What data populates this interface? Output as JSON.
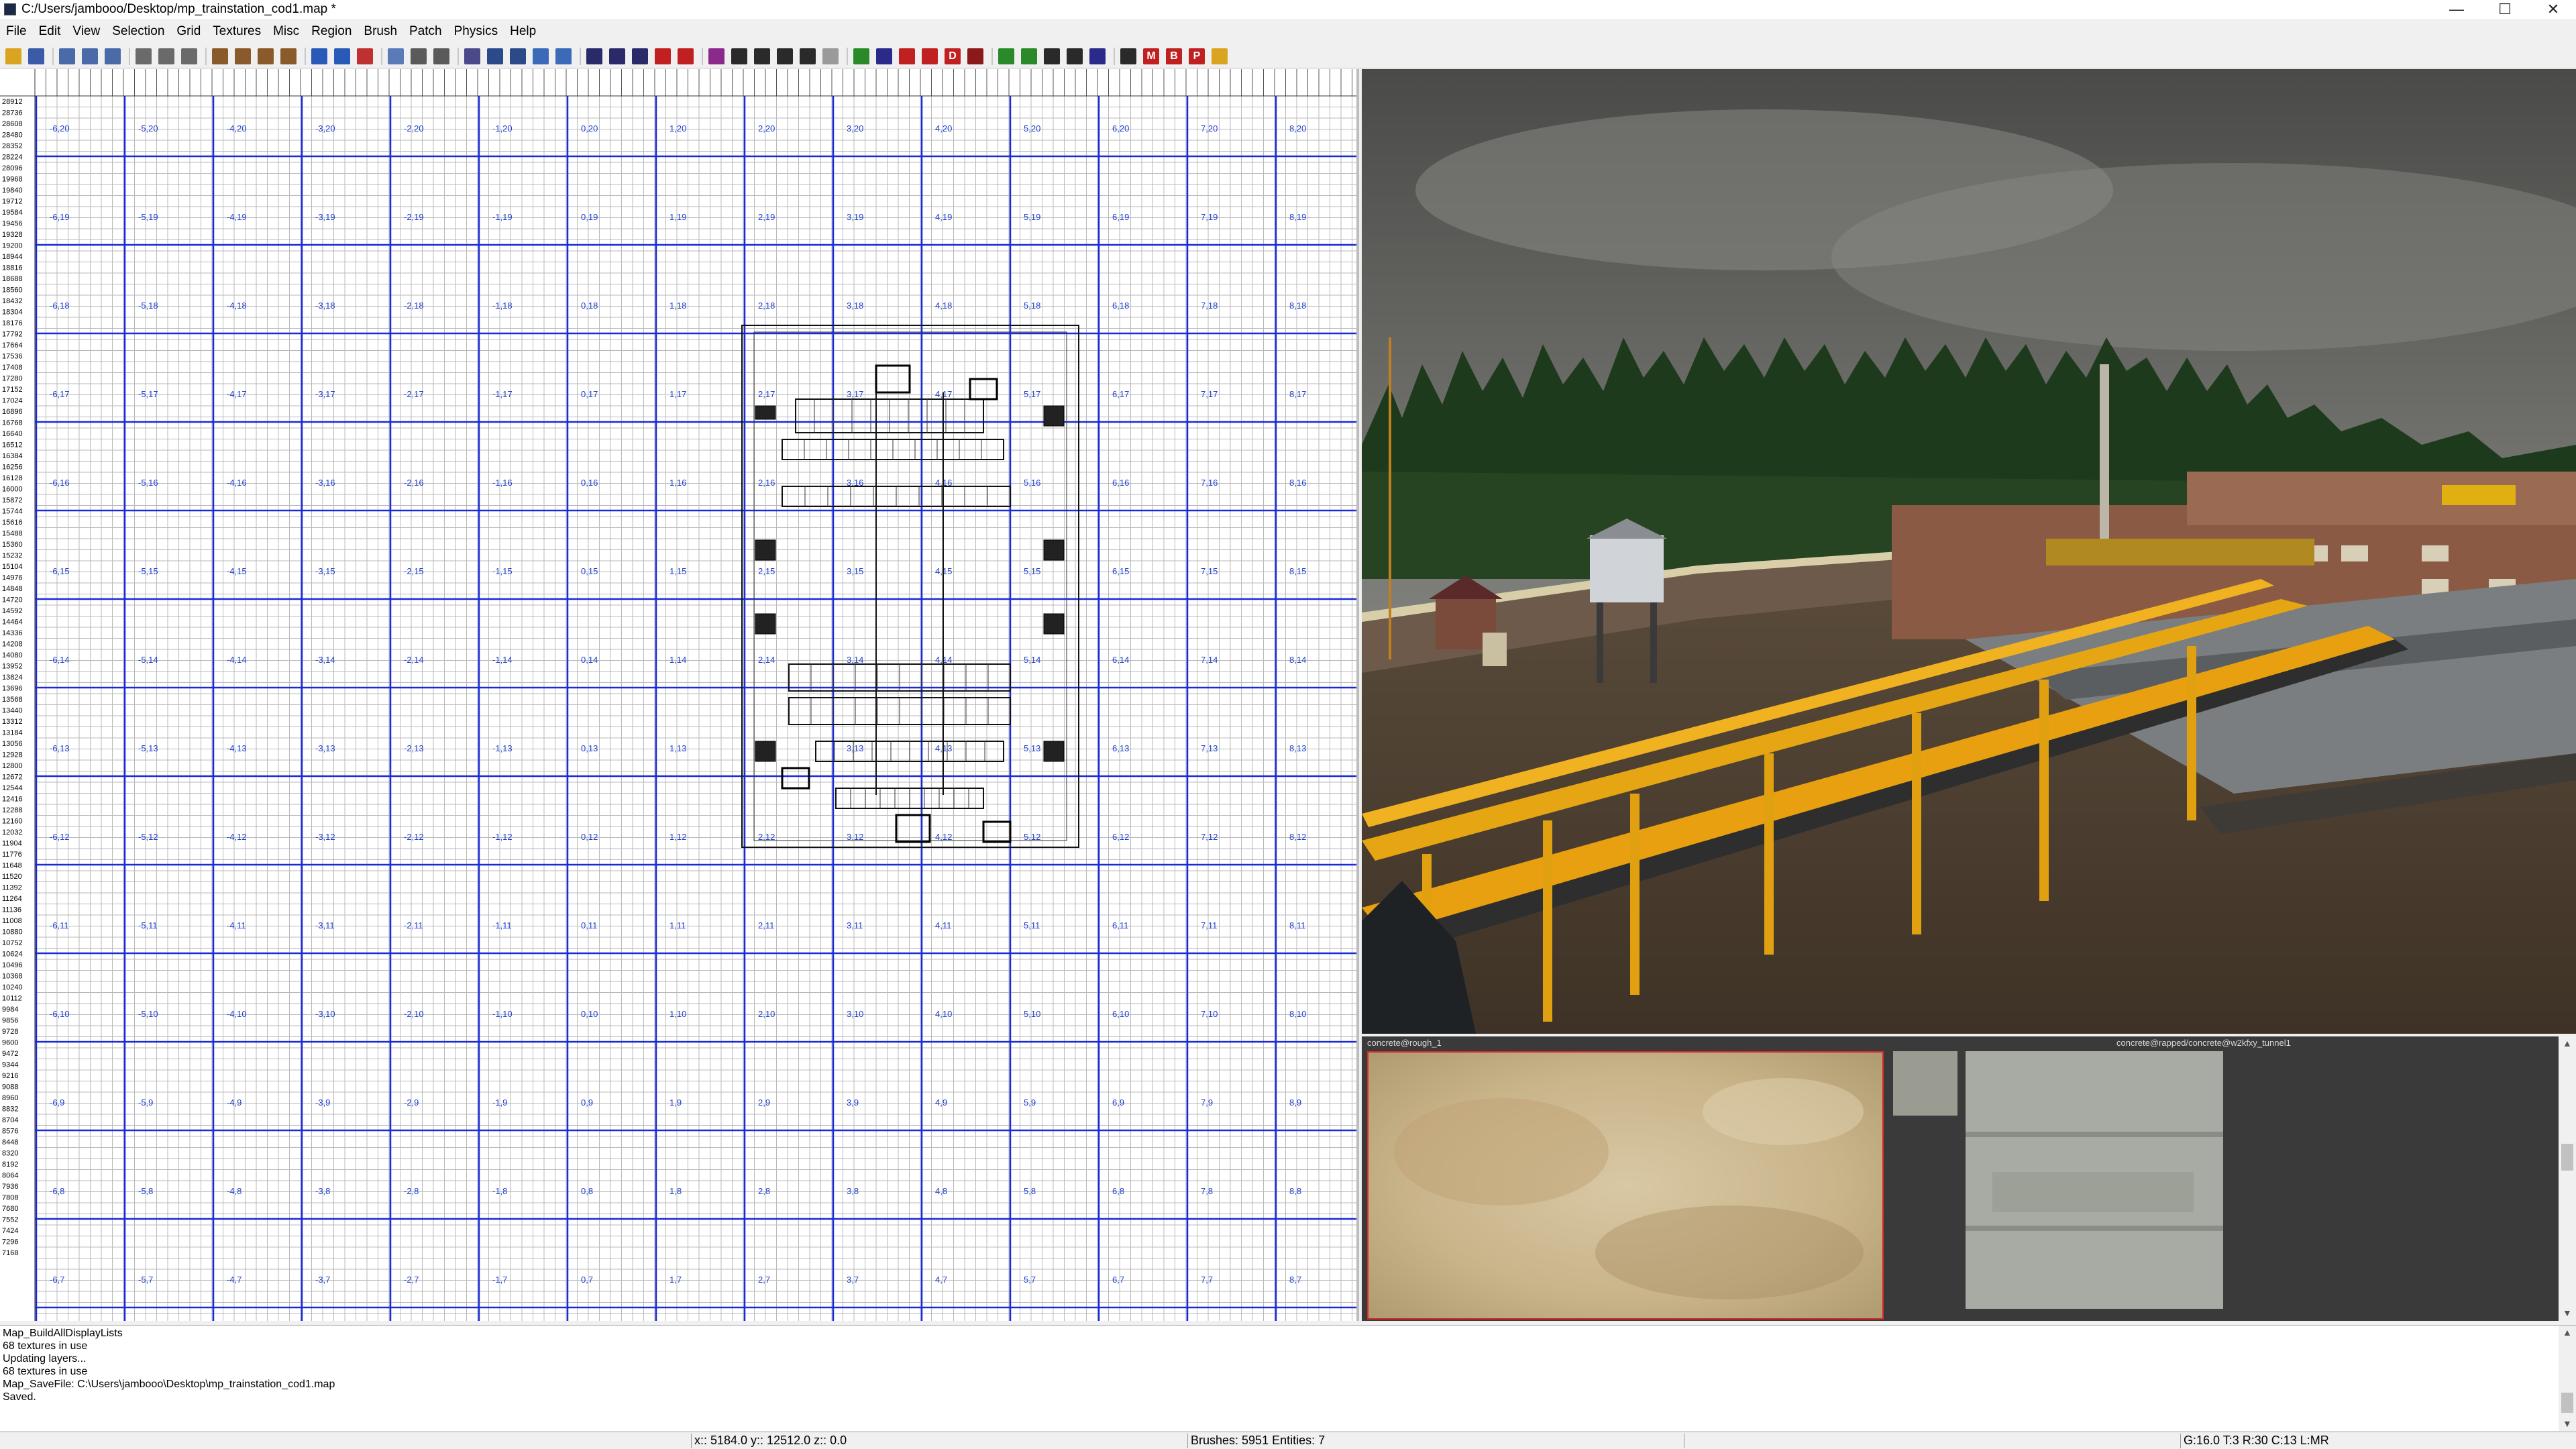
{
  "window": {
    "title": "C:/Users/jambooo/Desktop/mp_trainstation_cod1.map *",
    "minimize": "—",
    "maximize": "☐",
    "close": "✕"
  },
  "menu": {
    "items": [
      "File",
      "Edit",
      "View",
      "Selection",
      "Grid",
      "Textures",
      "Misc",
      "Region",
      "Brush",
      "Patch",
      "Physics",
      "Help"
    ]
  },
  "toolbar": {
    "buttons": [
      {
        "icon": "open-icon",
        "color": "#d9a520"
      },
      {
        "icon": "save-icon",
        "color": "#3b5aa8"
      },
      {
        "icon": "flip-x-icon",
        "color": "#4a6aa8"
      },
      {
        "icon": "flip-y-icon",
        "color": "#4a6aa8"
      },
      {
        "icon": "flip-z-icon",
        "color": "#4a6aa8"
      },
      {
        "icon": "rotate-x-icon",
        "color": "#6a6a6a"
      },
      {
        "icon": "rotate-y-icon",
        "color": "#6a6a6a"
      },
      {
        "icon": "rotate-z-icon",
        "color": "#6a6a6a"
      },
      {
        "icon": "select-complete-icon",
        "color": "#8a5a2a"
      },
      {
        "icon": "select-touching-icon",
        "color": "#8a5a2a"
      },
      {
        "icon": "select-partial-icon",
        "color": "#8a5a2a"
      },
      {
        "icon": "select-inside-icon",
        "color": "#8a5a2a"
      },
      {
        "icon": "clipper-icon",
        "color": "#2a5ab8"
      },
      {
        "icon": "csg-subtract-icon",
        "color": "#2a5ab8"
      },
      {
        "icon": "csg-merge-icon",
        "color": "#c03030"
      },
      {
        "icon": "hollow-icon",
        "color": "#5a7ab8"
      },
      {
        "icon": "change-views-icon",
        "color": "#5a5a5a"
      },
      {
        "icon": "texture-lock-icon",
        "color": "#5a5a5a"
      },
      {
        "icon": "cubic-clip-icon",
        "color": "#4a4a8a"
      },
      {
        "icon": "camera-icon",
        "color": "#2a4a8a"
      },
      {
        "icon": "patch-icon",
        "color": "#2a4a8a"
      },
      {
        "icon": "entity-icon",
        "color": "#3a6ab8"
      },
      {
        "icon": "bend-icon",
        "color": "#3a6ab8"
      },
      {
        "icon": "x-axis-icon",
        "color": "#2a2a6a"
      },
      {
        "icon": "y-axis-icon",
        "color": "#2a2a6a"
      },
      {
        "icon": "z-axis-icon",
        "color": "#2a2a6a"
      },
      {
        "icon": "scale-icon",
        "color": "#c02020"
      },
      {
        "icon": "weld-icon",
        "color": "#c02020"
      },
      {
        "icon": "drill-icon",
        "color": "#8a2a8a"
      },
      {
        "icon": "redisperse-icon",
        "color": "#2a2a2a"
      },
      {
        "icon": "show-curve-icon",
        "color": "#2a2a2a"
      },
      {
        "icon": "hide-icon",
        "color": "#2a2a2a"
      },
      {
        "icon": "caulk-icon",
        "color": "#2a2a2a"
      },
      {
        "icon": "filter-icon",
        "color": "#9a9a9a"
      },
      {
        "icon": "eyedropper-icon",
        "color": "#2a8a2a"
      },
      {
        "icon": "grid-icon",
        "color": "#2a2a8a"
      },
      {
        "icon": "light-icon",
        "color": "#c02020"
      },
      {
        "icon": "sun-icon",
        "color": "#c02020"
      },
      {
        "icon": "d-icon",
        "color": "#c02020"
      },
      {
        "icon": "model-icon",
        "color": "#8a1a1a"
      },
      {
        "icon": "arrow-down-icon",
        "color": "#2a8a2a"
      },
      {
        "icon": "arrow-down-alt-icon",
        "color": "#2a8a2a"
      },
      {
        "icon": "b-mode-icon",
        "color": "#2a2a2a"
      },
      {
        "icon": "tree-icon",
        "color": "#2a2a2a"
      },
      {
        "icon": "region-icon",
        "color": "#2a2a8a"
      },
      {
        "icon": "t-icon",
        "color": "#2a2a2a"
      },
      {
        "icon": "m-icon",
        "color": "#c02020"
      },
      {
        "icon": "b-icon",
        "color": "#c02020"
      },
      {
        "icon": "p-icon",
        "color": "#c02020"
      },
      {
        "icon": "play-icon",
        "color": "#d9a520"
      }
    ],
    "letters": {
      "m": "M",
      "b": "B",
      "p": "P",
      "d": "D"
    }
  },
  "grid_view": {
    "row_labels": [
      "28912",
      "28736",
      "28608",
      "28480",
      "28352",
      "28224",
      "28096",
      "19968",
      "19840",
      "19712",
      "19584",
      "19456",
      "19328",
      "19200",
      "18944",
      "18816",
      "18688",
      "18560",
      "18432",
      "18304",
      "18176",
      "17792",
      "17664",
      "17536",
      "17408",
      "17280",
      "17152",
      "17024",
      "16896",
      "16768",
      "16640",
      "16512",
      "16384",
      "16256",
      "16128",
      "16000",
      "15872",
      "15744",
      "15616",
      "15488",
      "15360",
      "15232",
      "15104",
      "14976",
      "14848",
      "14720",
      "14592",
      "14464",
      "14336",
      "14208",
      "14080",
      "13952",
      "13824",
      "13696",
      "13568",
      "13440",
      "13312",
      "13184",
      "13056",
      "12928",
      "12800",
      "12672",
      "12544",
      "12416",
      "12288",
      "12160",
      "12032",
      "11904",
      "11776",
      "11648",
      "11520",
      "11392",
      "11264",
      "11136",
      "11008",
      "10880",
      "10752",
      "10624",
      "10496",
      "10368",
      "10240",
      "10112",
      "9984",
      "9856",
      "9728",
      "9600",
      "9472",
      "9344",
      "9216",
      "9088",
      "8960",
      "8832",
      "8704",
      "8576",
      "8448",
      "8320",
      "8192",
      "8064",
      "7936",
      "7808",
      "7680",
      "7552",
      "7424",
      "7296",
      "7168"
    ],
    "col_labels": [
      "-6",
      "-5",
      "-4",
      "-3",
      "-2",
      "-1",
      "0",
      "1",
      "2",
      "3",
      "4",
      "5",
      "6",
      "7",
      "8"
    ],
    "block_row_labels": [
      "20",
      "19",
      "18",
      "17",
      "16",
      "15",
      "14",
      "13",
      "12",
      "11",
      "10",
      "9",
      "8",
      "7"
    ],
    "cell_text_color": "#1f3fd0"
  },
  "texture_browser": {
    "textures": [
      {
        "name": "concrete@rough_1"
      },
      {
        "name": "concrete@rapped/concrete@w2kfxy_tunnel1"
      }
    ]
  },
  "console": {
    "lines": [
      "Map_BuildAllDisplayLists",
      "68 textures in use",
      "Updating layers...",
      "68 textures in use",
      "Map_SaveFile: C:\\Users\\jambooo\\Desktop\\mp_trainstation_cod1.map",
      "Saved."
    ]
  },
  "status": {
    "coords": "x:: 5184.0  y:: 12512.0  z:: 0.0",
    "counts": "Brushes: 5951 Entities: 7",
    "grid": "G:16.0 T:3 R:30 C:13 L:MR"
  }
}
